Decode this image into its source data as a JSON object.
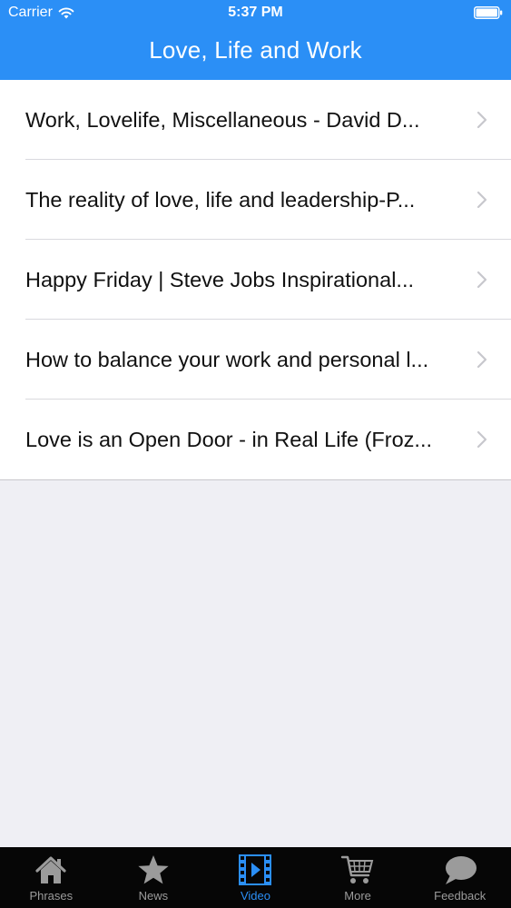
{
  "status_bar": {
    "carrier": "Carrier",
    "time": "5:37 PM"
  },
  "nav": {
    "title": "Love, Life and Work"
  },
  "list": {
    "items": [
      {
        "title": "Work, Lovelife, Miscellaneous - David D..."
      },
      {
        "title": "The reality of love, life and leadership-P..."
      },
      {
        "title": "Happy Friday | Steve Jobs Inspirational..."
      },
      {
        "title": "How to balance your work and personal l..."
      },
      {
        "title": "Love is an Open Door - in Real Life (Froz..."
      }
    ]
  },
  "tabs": [
    {
      "label": "Phrases",
      "icon": "house-icon"
    },
    {
      "label": "News",
      "icon": "star-icon"
    },
    {
      "label": "Video",
      "icon": "film-icon",
      "active": true
    },
    {
      "label": "More",
      "icon": "cart-icon"
    },
    {
      "label": "Feedback",
      "icon": "speech-bubble-icon"
    }
  ],
  "colors": {
    "accent": "#2b8ff6",
    "tab_bar_bg": "#060606",
    "page_bg": "#efeff4",
    "tab_inactive": "#9b9b9b"
  }
}
